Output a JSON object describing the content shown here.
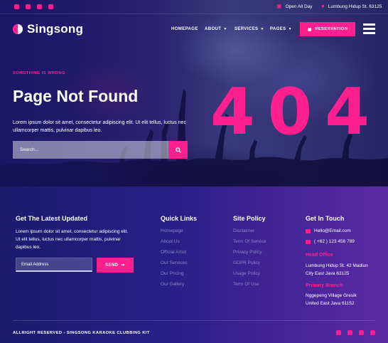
{
  "topbar": {
    "social": [
      "facebook-icon",
      "twitter-icon",
      "youtube-icon",
      "linkedin-icon"
    ],
    "hours": "Open All Day",
    "address": "Lumbung Hidup St. 63125"
  },
  "nav": {
    "brand": "Singsong",
    "items": [
      {
        "label": "HOMEPAGE",
        "has_dropdown": false
      },
      {
        "label": "ABOUT",
        "has_dropdown": true
      },
      {
        "label": "SERVICES",
        "has_dropdown": true
      },
      {
        "label": "PAGES",
        "has_dropdown": true
      }
    ],
    "reservation_label": "RESERVATION"
  },
  "hero": {
    "error_label": "SOMETHING IS WRONG",
    "title": "Page Not Found",
    "description": "Lorem ipsum dolor sit amet, consectetur adipiscing elit. Ut elit tellus, luctus nec ullamcorper mattis, pulvinar dapibus leo.",
    "search_placeholder": "Search...",
    "code": "404"
  },
  "footer": {
    "newsletter": {
      "title": "Get The Latest Updated",
      "description": "Lorem ipsum dolor sit amet, consectetur adipiscing elit. Ut elit tellus, luctus nec ullamcorper mattis, pulvinar dapibus leo.",
      "email_placeholder": "Email Address",
      "send_label": "SEND"
    },
    "quick_links": {
      "title": "Quick Links",
      "items": [
        "Homepage",
        "About Us",
        "Official Artist",
        "Our Services",
        "Our Pricing",
        "Our Gallery"
      ]
    },
    "site_policy": {
      "title": "Site Policy",
      "items": [
        "Disclaimer",
        "Term Of Service",
        "Privacy Policy",
        "GDPR Policy",
        "Usage Policy",
        "Term Of Use"
      ]
    },
    "contact": {
      "title": "Get In Touch",
      "email": "Hello@Email.com",
      "phone": "( +62 ) 123 456 789",
      "head_office_label": "Head Office",
      "head_office_address": "Lumbung Hidup St. 42 Madiun City East Java 63125",
      "primary_branch_label": "Primary Branch",
      "primary_branch_address": "Nggepeng Village Gresik United East Java 61152"
    },
    "copyright": "ALLRIGHT RESERVED - SINGSONG KARAOKE CLUBBING KIT",
    "social": [
      "facebook-icon",
      "twitter-icon",
      "youtube-icon",
      "linkedin-icon"
    ]
  },
  "colors": {
    "accent": "#ff1f8e",
    "footer_start": "#1c1a6e",
    "footer_end": "#5c2aa4"
  }
}
